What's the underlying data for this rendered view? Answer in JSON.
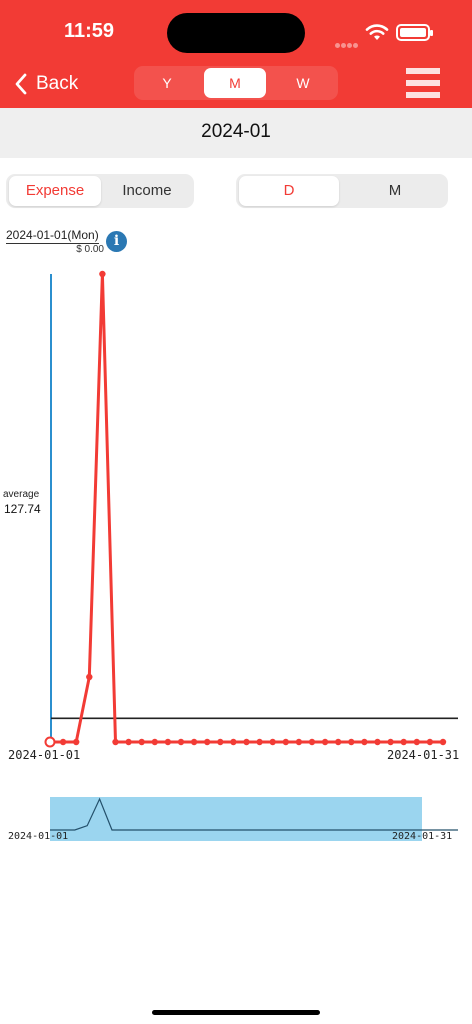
{
  "status_bar": {
    "time": "11:59"
  },
  "nav": {
    "back_label": "Back",
    "period_options": [
      "Y",
      "M",
      "W"
    ],
    "period_selected": "M"
  },
  "date_nav": {
    "title": "2024-01"
  },
  "type_segment": {
    "options": [
      "Expense",
      "Income"
    ],
    "selected": "Expense"
  },
  "granularity_segment": {
    "options": [
      "D",
      "M"
    ],
    "selected": "D"
  },
  "selection": {
    "date": "2024-01-01(Mon)",
    "amount": "$ 0.00"
  },
  "average": {
    "label": "average",
    "value": "127.74"
  },
  "colors": {
    "accent": "#f23b35",
    "axis": "#2b8fce",
    "navigator_fill": "#9bd5ef",
    "average_line": "#222222"
  },
  "chart_data": {
    "type": "line",
    "x": [
      "2024-01-01",
      "2024-01-02",
      "2024-01-03",
      "2024-01-04",
      "2024-01-05",
      "2024-01-06",
      "2024-01-07",
      "2024-01-08",
      "2024-01-09",
      "2024-01-10",
      "2024-01-11",
      "2024-01-12",
      "2024-01-13",
      "2024-01-14",
      "2024-01-15",
      "2024-01-16",
      "2024-01-17",
      "2024-01-18",
      "2024-01-19",
      "2024-01-20",
      "2024-01-21",
      "2024-01-22",
      "2024-01-23",
      "2024-01-24",
      "2024-01-25",
      "2024-01-26",
      "2024-01-27",
      "2024-01-28",
      "2024-01-29",
      "2024-01-30",
      "2024-01-31"
    ],
    "values": [
      0,
      0,
      0,
      350,
      2520,
      0,
      0,
      0,
      0,
      0,
      0,
      0,
      0,
      0,
      0,
      0,
      0,
      0,
      0,
      0,
      0,
      0,
      0,
      0,
      0,
      0,
      0,
      0,
      0,
      0,
      0
    ],
    "ylim": [
      0,
      2520
    ],
    "average": 127.74,
    "x_start_label": "2024-01-01",
    "x_end_label": "2024-01-31",
    "navigator": {
      "x_start_label": "2024-01-01",
      "x_end_label": "2024-01-31"
    }
  }
}
